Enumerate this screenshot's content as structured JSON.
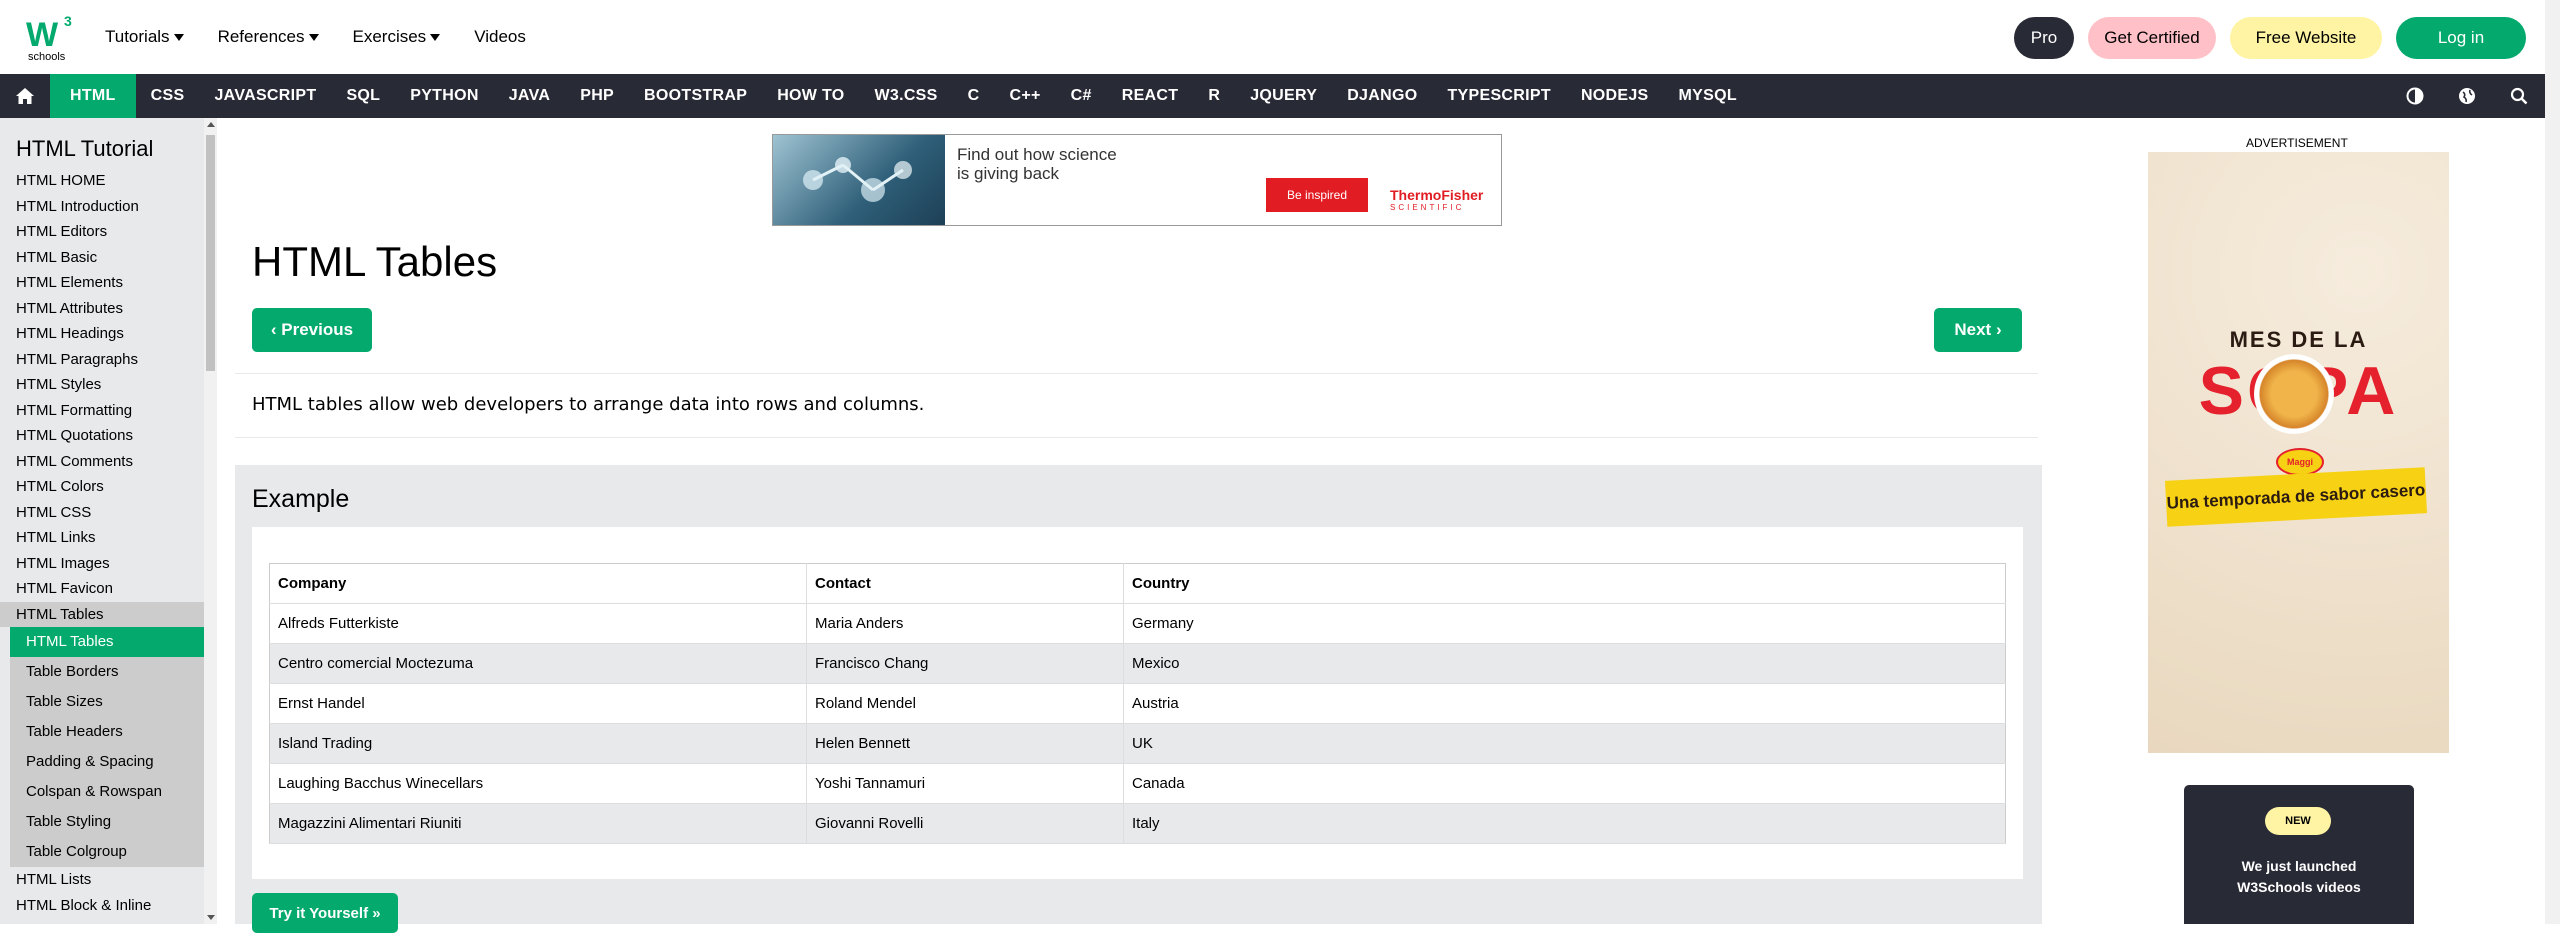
{
  "topbar": {
    "logo_text": "schools",
    "logo_superscript": "3",
    "menu": [
      {
        "label": "Tutorials",
        "dropdown": true
      },
      {
        "label": "References",
        "dropdown": true
      },
      {
        "label": "Exercises",
        "dropdown": true
      },
      {
        "label": "Videos",
        "dropdown": false
      }
    ],
    "pro_label": "Pro",
    "certified_label": "Get Certified",
    "website_label": "Free Website",
    "login_label": "Log in"
  },
  "navbar": {
    "items": [
      "HTML",
      "CSS",
      "JAVASCRIPT",
      "SQL",
      "PYTHON",
      "JAVA",
      "PHP",
      "BOOTSTRAP",
      "HOW TO",
      "W3.CSS",
      "C",
      "C++",
      "C#",
      "REACT",
      "R",
      "JQUERY",
      "DJANGO",
      "TYPESCRIPT",
      "NODEJS",
      "MYSQL"
    ],
    "active": "HTML"
  },
  "sidebar": {
    "title": "HTML Tutorial",
    "items": [
      "HTML HOME",
      "HTML Introduction",
      "HTML Editors",
      "HTML Basic",
      "HTML Elements",
      "HTML Attributes",
      "HTML Headings",
      "HTML Paragraphs",
      "HTML Styles",
      "HTML Formatting",
      "HTML Quotations",
      "HTML Comments",
      "HTML Colors",
      "HTML CSS",
      "HTML Links",
      "HTML Images",
      "HTML Favicon",
      "HTML Tables"
    ],
    "subitems": [
      "HTML Tables",
      "Table Borders",
      "Table Sizes",
      "Table Headers",
      "Padding & Spacing",
      "Colspan & Rowspan",
      "Table Styling",
      "Table Colgroup"
    ],
    "after": [
      "HTML Lists",
      "HTML Block & Inline"
    ]
  },
  "ad_banner": {
    "text_line1": "Find out how science",
    "text_line2": "is giving back",
    "button": "Be inspired",
    "brand_line1": "ThermoFisher",
    "brand_line2": "SCIENTIFIC"
  },
  "main": {
    "title": "HTML Tables",
    "prev_label": "‹ Previous",
    "next_label": "Next ›",
    "intro": "HTML tables allow web developers to arrange data into rows and columns.",
    "example_title": "Example",
    "try_label": "Try it Yourself »",
    "table": {
      "headers": [
        "Company",
        "Contact",
        "Country"
      ],
      "rows": [
        [
          "Alfreds Futterkiste",
          "Maria Anders",
          "Germany"
        ],
        [
          "Centro comercial Moctezuma",
          "Francisco Chang",
          "Mexico"
        ],
        [
          "Ernst Handel",
          "Roland Mendel",
          "Austria"
        ],
        [
          "Island Trading",
          "Helen Bennett",
          "UK"
        ],
        [
          "Laughing Bacchus Winecellars",
          "Yoshi Tannamuri",
          "Canada"
        ],
        [
          "Magazzini Alimentari Riuniti",
          "Giovanni Rovelli",
          "Italy"
        ]
      ]
    }
  },
  "right_ad": {
    "label": "ADVERTISEMENT",
    "line1": "MES DE LA",
    "line2": "SOPA",
    "brand": "Maggi",
    "tagline": "Una temporada de sabor casero"
  },
  "new_box": {
    "badge": "NEW",
    "line1": "We just launched",
    "line2": "W3Schools videos"
  },
  "colors": {
    "accent": "#04AA6D",
    "nav_bg": "#282a35",
    "sidebar_bg": "#e7e9eb"
  }
}
